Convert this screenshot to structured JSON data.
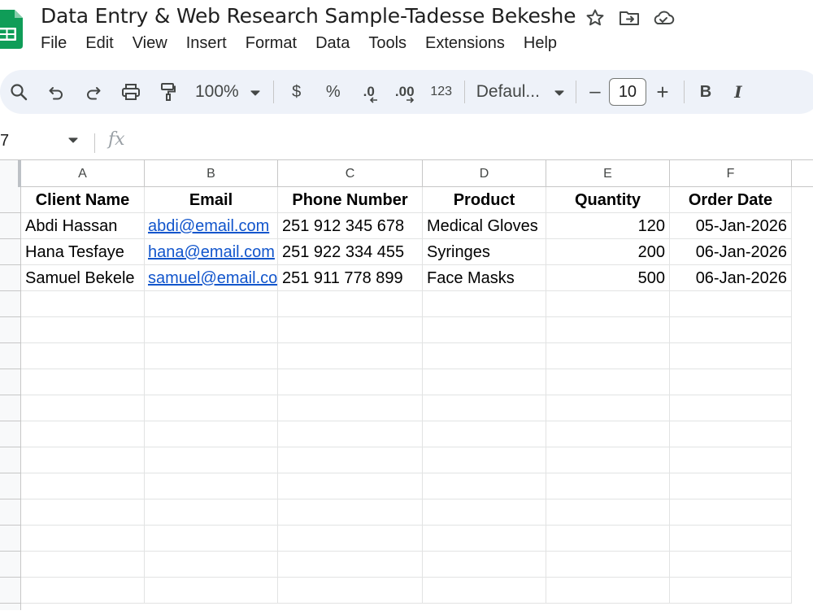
{
  "document": {
    "title": "Data Entry & Web Research Sample-Tadesse Bekeshe"
  },
  "menu": [
    "File",
    "Edit",
    "View",
    "Insert",
    "Format",
    "Data",
    "Tools",
    "Extensions",
    "Help"
  ],
  "toolbar": {
    "zoom": "100%",
    "currency": "$",
    "percent": "%",
    "decrease_decimal": ".0",
    "increase_decimal": ".00",
    "number_format": "123",
    "font": "Defaul...",
    "font_size": "10",
    "bold": "B",
    "italic": "I",
    "minus": "–",
    "plus": "+"
  },
  "formula_bar": {
    "name_box": "7",
    "fx": "fx"
  },
  "columns": [
    "A",
    "B",
    "C",
    "D",
    "E",
    "F"
  ],
  "table": {
    "headers": [
      "Client Name",
      "Email",
      "Phone Number",
      "Product",
      "Quantity",
      "Order Date"
    ],
    "rows": [
      [
        "Abdi Hassan",
        "abdi@email.com",
        "251 912 345 678",
        "Medical Gloves",
        "120",
        "05-Jan-2026"
      ],
      [
        "Hana Tesfaye",
        "hana@email.com",
        "251 922 334 455",
        "Syringes",
        "200",
        "06-Jan-2026"
      ],
      [
        "Samuel Bekele",
        "samuel@email.co",
        "251 911 778 899",
        "Face Masks",
        "500",
        "06-Jan-2026"
      ]
    ]
  },
  "colors": {
    "toolbar_bg": "#eef2f9",
    "link": "#1155cc",
    "sheets_green": "#0f9d58"
  }
}
